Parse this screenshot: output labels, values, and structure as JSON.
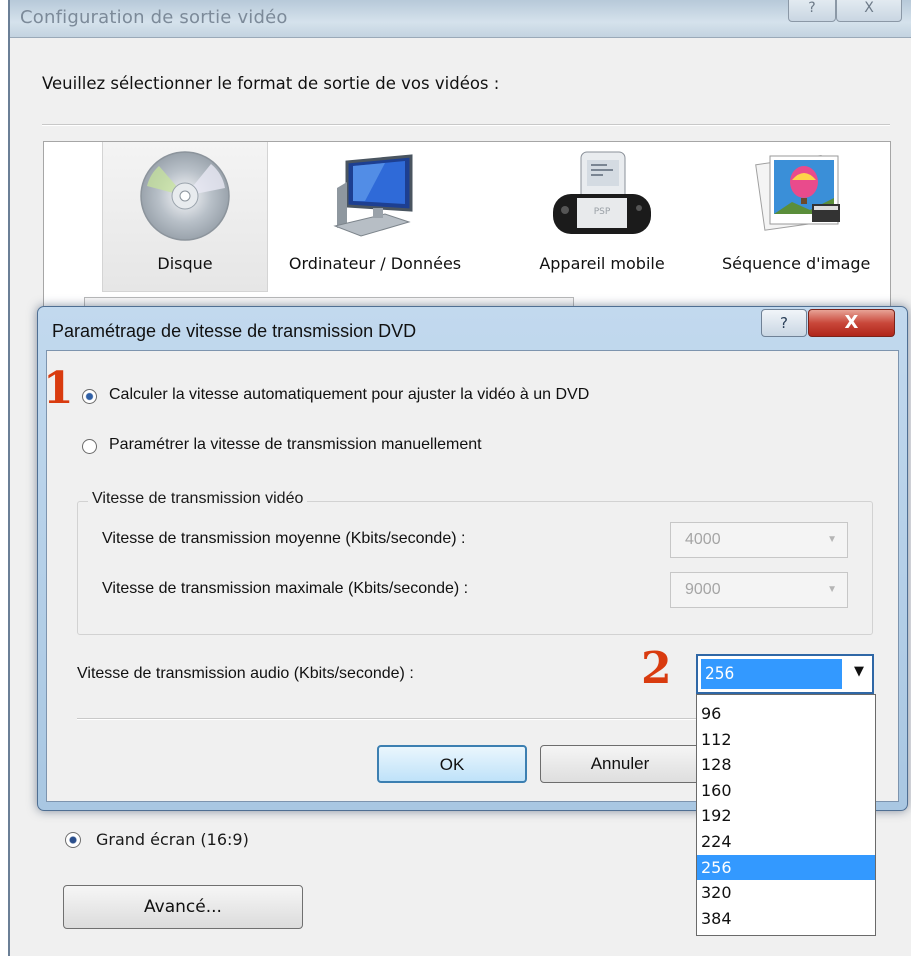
{
  "outer_window": {
    "title": "Configuration de sortie vidéo",
    "help_glyph": "?",
    "close_glyph": "X",
    "prompt": "Veuillez sélectionner le format de sortie de vos vidéos :",
    "formats": [
      {
        "label": "Disque",
        "icon": "disc-icon",
        "selected": true
      },
      {
        "label": "Ordinateur / Données",
        "icon": "computer-monitor-icon",
        "selected": false
      },
      {
        "label": "Appareil mobile",
        "icon": "psp-device-icon",
        "selected": false
      },
      {
        "label": "Séquence d'image",
        "icon": "image-sequence-icon",
        "selected": false
      }
    ],
    "psp_text": "PSP",
    "widescreen_label": "Grand écran (16:9)",
    "advanced_button": "Avancé..."
  },
  "dialog": {
    "title": "Paramétrage de vitesse de transmission DVD",
    "help_glyph": "?",
    "close_glyph": "X",
    "marker_1": "1",
    "marker_2": "2",
    "radio_auto": "Calculer la vitesse automatiquement pour ajuster la vidéo à un DVD",
    "radio_manual": "Paramétrer la vitesse de transmission manuellement",
    "video_group": {
      "legend": "Vitesse de transmission vidéo",
      "average_label": "Vitesse de transmission moyenne (Kbits/seconde) :",
      "average_value": "4000",
      "max_label": "Vitesse de transmission maximale (Kbits/seconde) :",
      "max_value": "9000"
    },
    "audio_label": "Vitesse de transmission audio (Kbits/seconde) :",
    "audio_value": "256",
    "audio_options": [
      "96",
      "112",
      "128",
      "160",
      "192",
      "224",
      "256",
      "320",
      "384"
    ],
    "audio_highlighted": "256",
    "ok_button": "OK",
    "cancel_button": "Annuler"
  },
  "colors": {
    "accent_selection": "#3399ff",
    "marker_red": "#d93b0f",
    "close_red": "#c9473a"
  }
}
